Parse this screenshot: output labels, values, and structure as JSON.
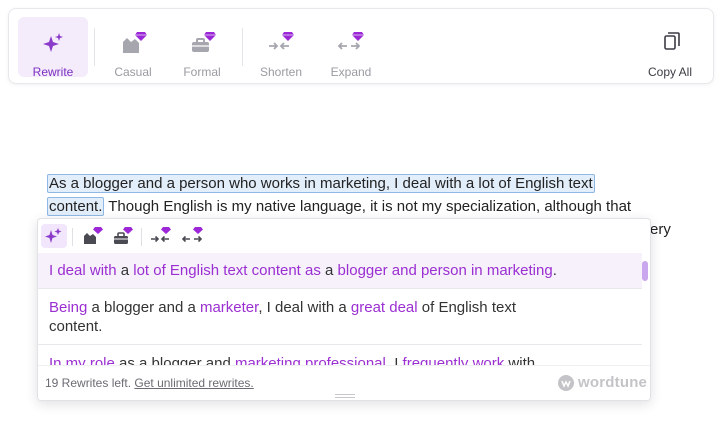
{
  "toolbar": {
    "tools": [
      {
        "label": "Rewrite",
        "icon": "sparkles-icon"
      },
      {
        "label": "Casual",
        "icon": "casual-icon"
      },
      {
        "label": "Formal",
        "icon": "briefcase-icon"
      },
      {
        "label": "Shorten",
        "icon": "shorten-icon"
      },
      {
        "label": "Expand",
        "icon": "expand-icon"
      }
    ],
    "copy_all": "Copy All"
  },
  "paragraph": {
    "selected_line1": "As a blogger and a person who works in marketing, I deal with a lot of English text",
    "selected_line2": "content.",
    "rest_line2": " Though English is my native language, it is not my specialization, although that",
    "cut_word": "ery"
  },
  "popup": {
    "suggestions": [
      [
        {
          "t": "I deal with",
          "h": true
        },
        {
          "t": " a ",
          "h": false
        },
        {
          "t": "lot of English text content as",
          "h": true
        },
        {
          "t": " a ",
          "h": false
        },
        {
          "t": "blogger and person in marketing",
          "h": true
        },
        {
          "t": ".",
          "h": false
        }
      ],
      [
        {
          "t": "Being",
          "h": true
        },
        {
          "t": " a blogger and a ",
          "h": false
        },
        {
          "t": "marketer",
          "h": true
        },
        {
          "t": ", I deal with a ",
          "h": false
        },
        {
          "t": "great deal",
          "h": true
        },
        {
          "t": " of English text content.",
          "h": false
        }
      ],
      [
        {
          "t": "In my role",
          "h": true
        },
        {
          "t": " as a blogger and ",
          "h": false
        },
        {
          "t": "marketing professional",
          "h": true
        },
        {
          "t": ", I ",
          "h": false
        },
        {
          "t": "frequently work",
          "h": true
        },
        {
          "t": " with",
          "h": false
        }
      ]
    ],
    "rewrites_left": "19 Rewrites left.",
    "unlimited_link": "Get unlimited rewrites.",
    "brand": "wordtune"
  },
  "colors": {
    "accent": "#9b2fd1",
    "active_bg": "#f4ecfb",
    "selection_bg": "#e3eefb",
    "selection_border": "#8fb8e6",
    "premium_gem": "#9b27d6"
  }
}
